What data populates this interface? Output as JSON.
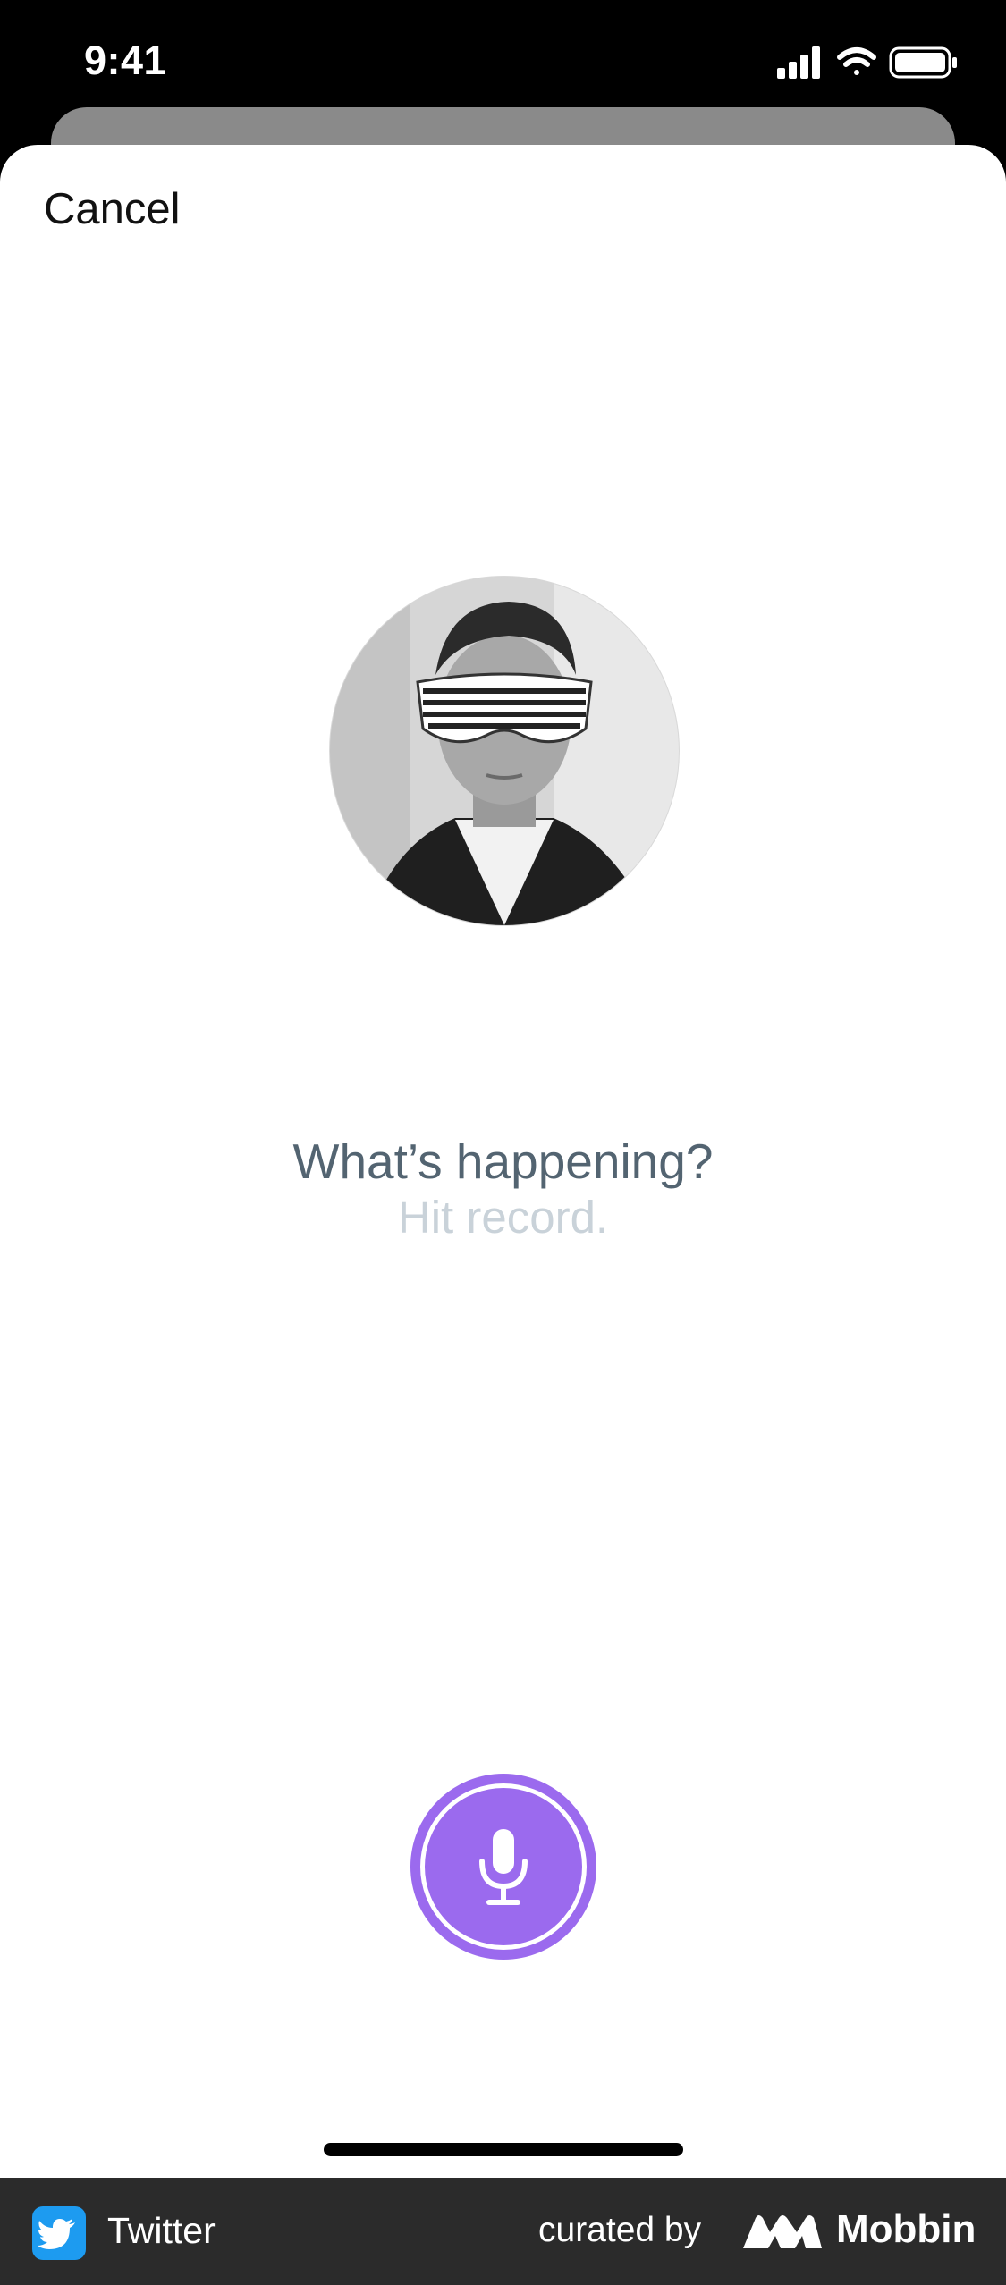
{
  "status_bar": {
    "time": "9:41",
    "icons": [
      "signal-icon",
      "wifi-icon",
      "battery-icon"
    ]
  },
  "header": {
    "cancel_label": "Cancel"
  },
  "main": {
    "avatar": "profile-photo",
    "title": "What’s happening?",
    "subtitle": "Hit record.",
    "record_button_icon": "microphone-icon",
    "record_color": "#9b6aee"
  },
  "footer": {
    "app_name": "Twitter",
    "curated_by": "curated by",
    "brand": "Mobbin",
    "twitter_color": "#1d9bf0"
  }
}
